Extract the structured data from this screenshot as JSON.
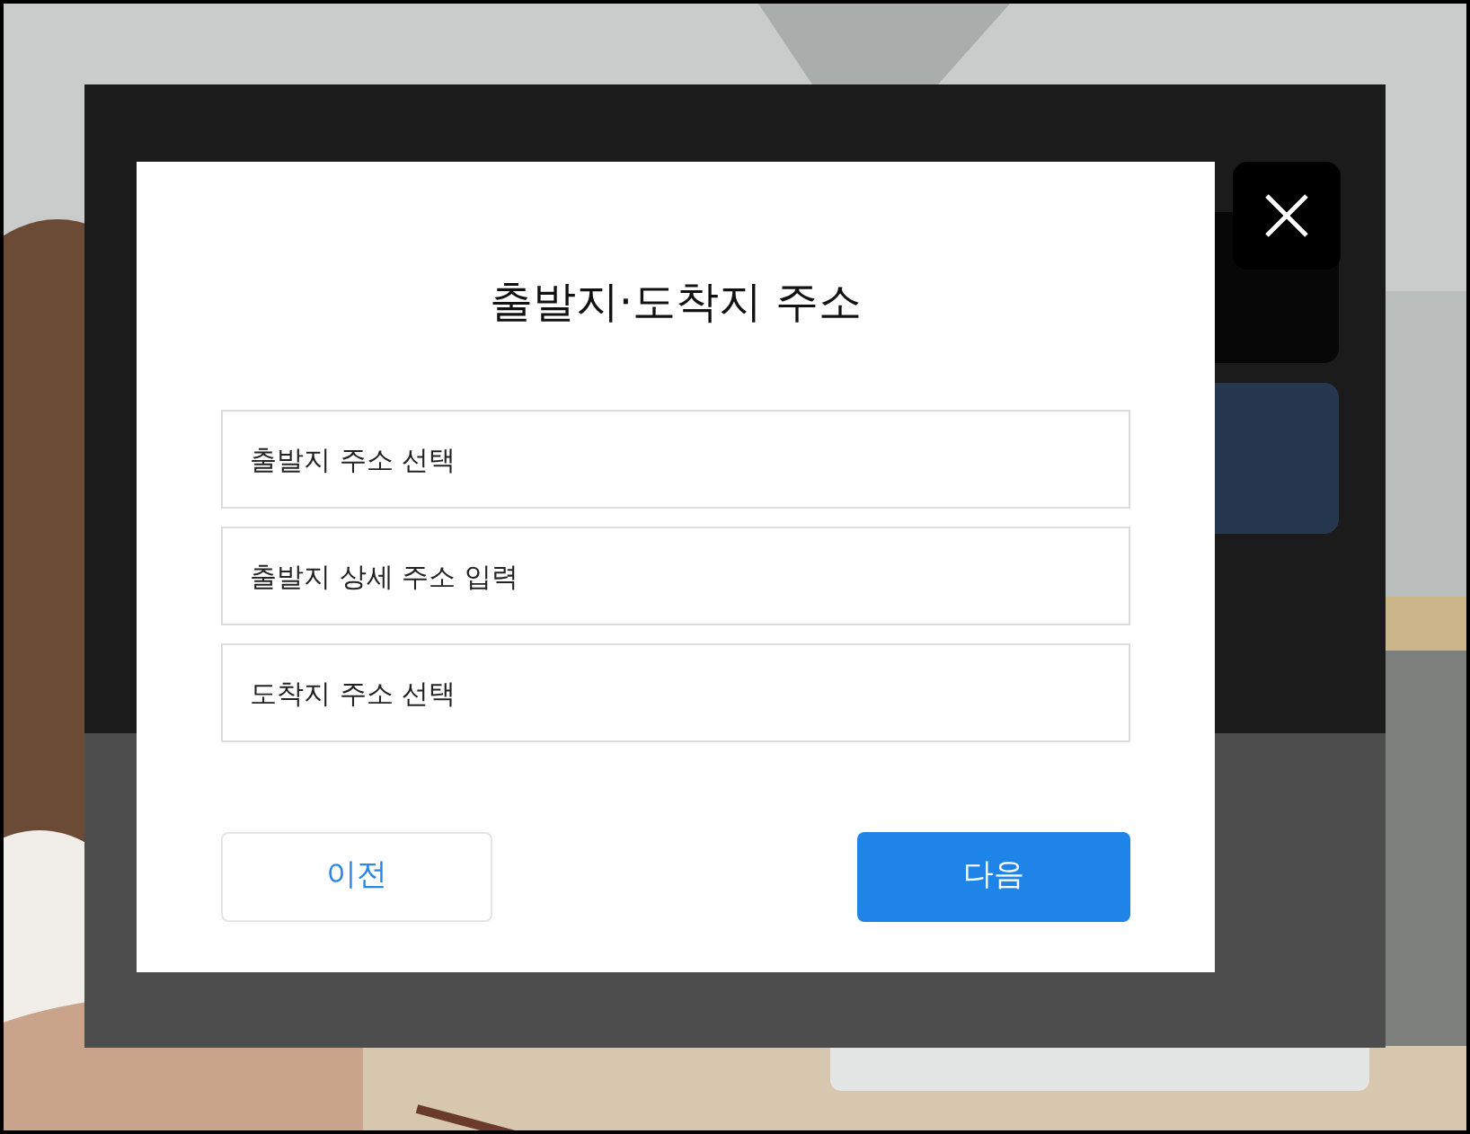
{
  "dialog": {
    "title": "출발지·도착지 주소",
    "fields": [
      {
        "placeholder": "출발지 주소 선택"
      },
      {
        "placeholder": "출발지 상세 주소 입력"
      },
      {
        "placeholder": "도착지 주소 선택"
      }
    ],
    "buttons": [
      {
        "label": "이전",
        "kind": "secondary"
      },
      {
        "label": "다음",
        "kind": "primary"
      }
    ]
  }
}
